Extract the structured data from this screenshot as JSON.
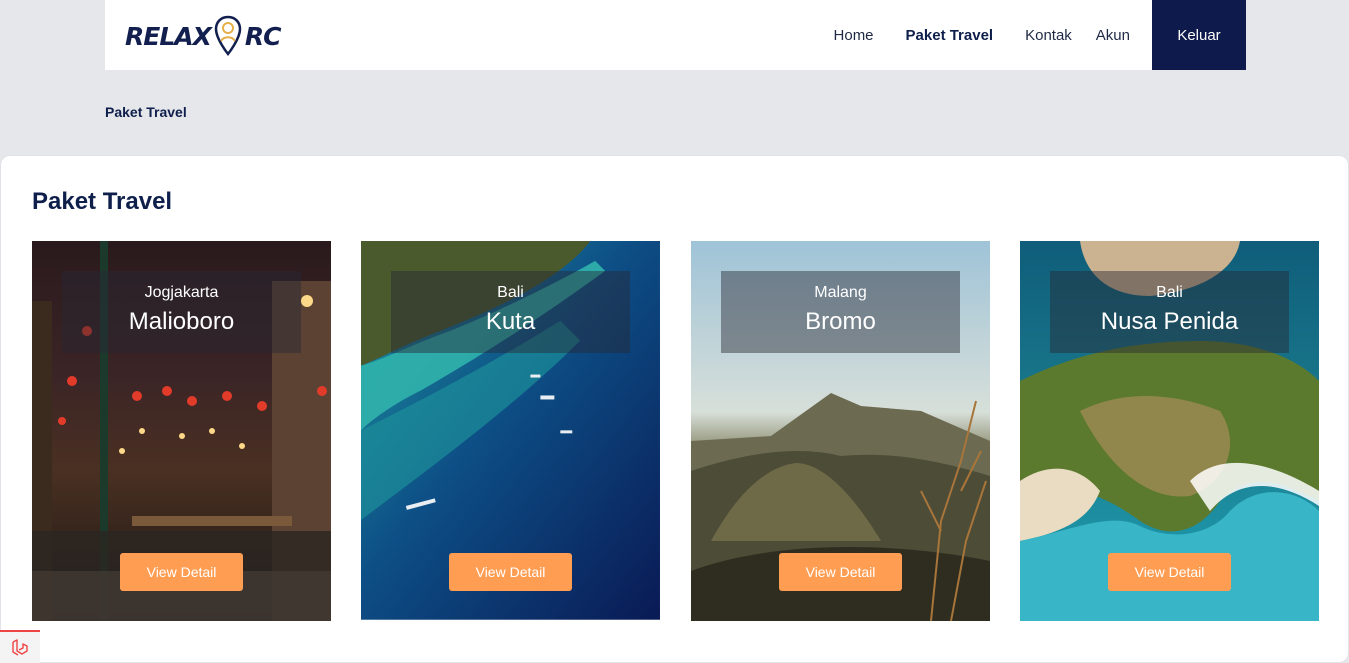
{
  "navbar": {
    "logo": {
      "left": "RELAX",
      "right": "RC"
    },
    "links": [
      {
        "label": "Home",
        "active": false
      },
      {
        "label": "Paket Travel",
        "active": true
      },
      {
        "label": "Kontak",
        "active": false
      },
      {
        "label": "Akun",
        "active": false
      }
    ],
    "logout_label": "Keluar"
  },
  "breadcrumb": "Paket Travel",
  "main": {
    "title": "Paket Travel",
    "packages": [
      {
        "region": "Jogjakarta",
        "name": "Malioboro",
        "button": "View Detail"
      },
      {
        "region": "Bali",
        "name": "Kuta",
        "button": "View Detail"
      },
      {
        "region": "Malang",
        "name": "Bromo",
        "button": "View Detail"
      },
      {
        "region": "Bali",
        "name": "Nusa Penida",
        "button": "View Detail"
      }
    ]
  },
  "colors": {
    "brand_navy": "#0e1a4c",
    "accent_orange": "#ff9e53",
    "page_bg": "#e5e7eb"
  }
}
